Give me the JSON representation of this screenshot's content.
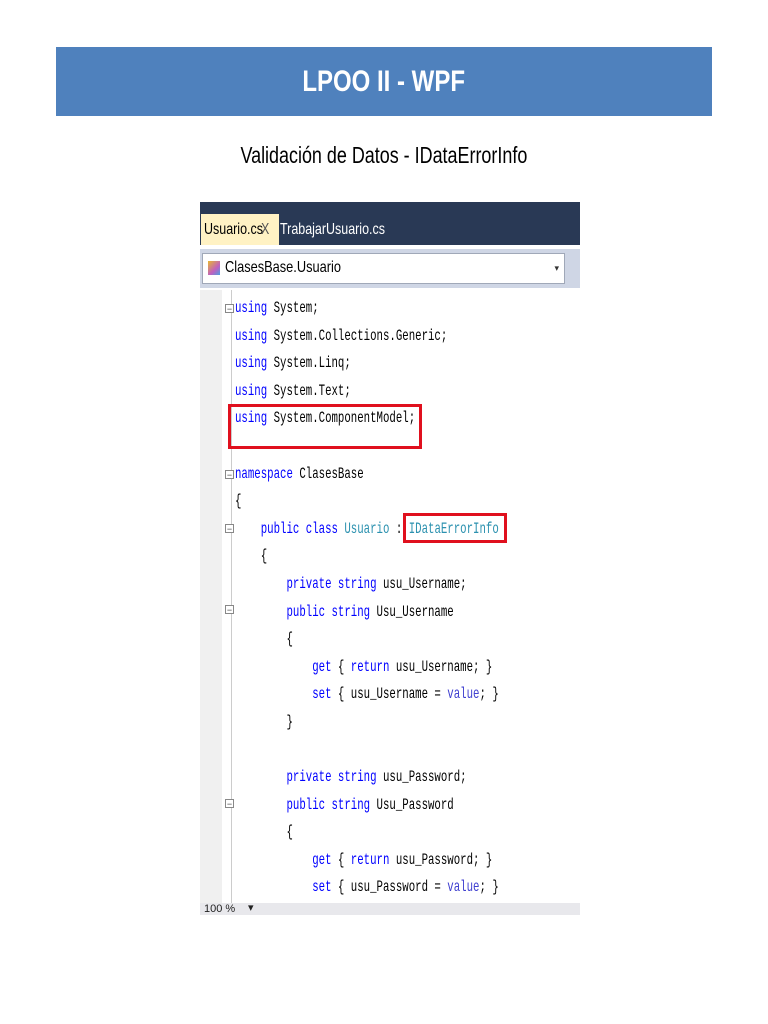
{
  "banner": {
    "title": "LPOO II - WPF"
  },
  "subtitle": "Validación de Datos - IDataErrorInfo",
  "ide": {
    "tabs": [
      {
        "label": "Usuario.cs",
        "close": "X"
      },
      {
        "label": "TrabajarUsuario.cs"
      }
    ],
    "navigation": {
      "selected": "ClasesBase.Usuario",
      "dropdown": "▾"
    },
    "zoom": "100 %",
    "zoom_dropdown": "▾",
    "code_lines": [
      [
        [
          "kw",
          "using"
        ],
        [
          "tx",
          " System;"
        ]
      ],
      [
        [
          "kw",
          "using"
        ],
        [
          "tx",
          " System.Collections.Generic;"
        ]
      ],
      [
        [
          "kw",
          "using"
        ],
        [
          "tx",
          " System.Linq;"
        ]
      ],
      [
        [
          "kw",
          "using"
        ],
        [
          "tx",
          " System.Text;"
        ]
      ],
      [
        [
          "kw",
          "using"
        ],
        [
          "tx",
          " System.ComponentModel;"
        ]
      ],
      [],
      [
        [
          "kw",
          "namespace"
        ],
        [
          "tx",
          " ClasesBase"
        ]
      ],
      [
        [
          "tx",
          "{"
        ]
      ],
      [
        [
          "tx",
          "    "
        ],
        [
          "kw",
          "public class"
        ],
        [
          "tx",
          " "
        ],
        [
          "ty",
          "Usuario"
        ],
        [
          "tx",
          " : "
        ],
        [
          "ty",
          "IDataErrorInfo"
        ]
      ],
      [
        [
          "tx",
          "    {"
        ]
      ],
      [
        [
          "tx",
          "        "
        ],
        [
          "kw",
          "private string"
        ],
        [
          "tx",
          " usu_Username;"
        ]
      ],
      [
        [
          "tx",
          "        "
        ],
        [
          "kw",
          "public string"
        ],
        [
          "tx",
          " Usu_Username"
        ]
      ],
      [
        [
          "tx",
          "        {"
        ]
      ],
      [
        [
          "tx",
          "            "
        ],
        [
          "kw",
          "get"
        ],
        [
          "tx",
          " { "
        ],
        [
          "kw",
          "return"
        ],
        [
          "tx",
          " usu_Username; }"
        ]
      ],
      [
        [
          "tx",
          "            "
        ],
        [
          "kw",
          "set"
        ],
        [
          "tx",
          " { usu_Username = "
        ],
        [
          "vl",
          "value"
        ],
        [
          "tx",
          "; }"
        ]
      ],
      [
        [
          "tx",
          "        }"
        ]
      ],
      [],
      [
        [
          "tx",
          "        "
        ],
        [
          "kw",
          "private string"
        ],
        [
          "tx",
          " usu_Password;"
        ]
      ],
      [
        [
          "tx",
          "        "
        ],
        [
          "kw",
          "public string"
        ],
        [
          "tx",
          " Usu_Password"
        ]
      ],
      [
        [
          "tx",
          "        {"
        ]
      ],
      [
        [
          "tx",
          "            "
        ],
        [
          "kw",
          "get"
        ],
        [
          "tx",
          " { "
        ],
        [
          "kw",
          "return"
        ],
        [
          "tx",
          " usu_Password; }"
        ]
      ],
      [
        [
          "tx",
          "            "
        ],
        [
          "kw",
          "set"
        ],
        [
          "tx",
          " { usu_Password = "
        ],
        [
          "vl",
          "value"
        ],
        [
          "tx",
          "; }"
        ]
      ]
    ]
  }
}
